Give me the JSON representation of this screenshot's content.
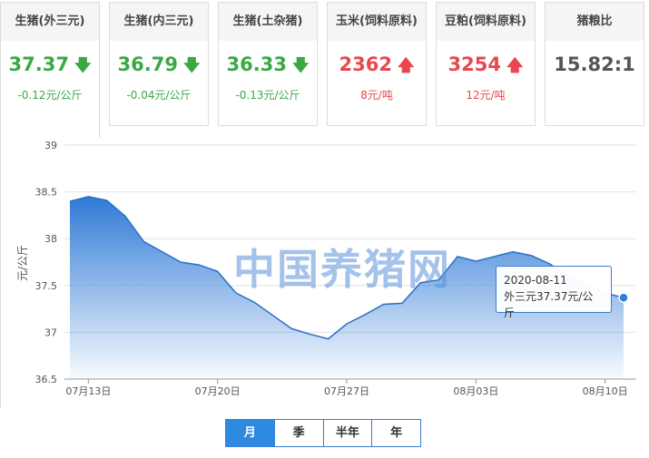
{
  "cards": [
    {
      "title": "生猪(外三元)",
      "price": "37.37",
      "change": "-0.12元/公斤",
      "trend": "down"
    },
    {
      "title": "生猪(内三元)",
      "price": "36.79",
      "change": "-0.04元/公斤",
      "trend": "down"
    },
    {
      "title": "生猪(土杂猪)",
      "price": "36.33",
      "change": "-0.13元/公斤",
      "trend": "down"
    },
    {
      "title": "玉米(饲料原料)",
      "price": "2362",
      "change": "8元/吨",
      "trend": "up"
    },
    {
      "title": "豆粕(饲料原料)",
      "price": "3254",
      "change": "12元/吨",
      "trend": "up"
    },
    {
      "title": "猪粮比",
      "price": "15.82:1",
      "change": "",
      "trend": "none"
    }
  ],
  "icons": {
    "down": "arrow-down-icon",
    "up": "arrow-up-icon"
  },
  "colors": {
    "down": "#3aa845",
    "up": "#e8474f",
    "accent": "#2d8ae0",
    "area_top": "#2f7ad6"
  },
  "chart_data": {
    "type": "area",
    "ylabel": "元/公斤",
    "ylim": [
      36.5,
      39
    ],
    "yticks": [
      "39",
      "38.5",
      "38",
      "37.5",
      "37",
      "36.5"
    ],
    "xtick_labels": [
      "07月13日",
      "07月20日",
      "07月27日",
      "08月03日",
      "08月10日"
    ],
    "xtick_days": [
      1,
      8,
      15,
      22,
      29
    ],
    "x_days": [
      0,
      1,
      2,
      3,
      4,
      5,
      6,
      7,
      8,
      9,
      10,
      11,
      12,
      13,
      14,
      15,
      16,
      17,
      18,
      19,
      20,
      21,
      22,
      23,
      24,
      25,
      26,
      27,
      28,
      29,
      30
    ],
    "values": [
      38.4,
      38.45,
      38.41,
      38.24,
      37.97,
      37.86,
      37.75,
      37.72,
      37.65,
      37.42,
      37.32,
      37.18,
      37.04,
      36.98,
      36.93,
      37.09,
      37.19,
      37.3,
      37.31,
      37.53,
      37.56,
      37.81,
      37.76,
      37.81,
      37.86,
      37.82,
      37.73,
      37.6,
      37.5,
      37.42,
      37.37
    ],
    "grid": true,
    "legend": "none",
    "watermark": "中国养猪网"
  },
  "tooltip": {
    "date": "2020-08-11",
    "text": "外三元37.37元/公斤"
  },
  "ranges": {
    "labels": [
      "月",
      "季",
      "半年",
      "年"
    ],
    "active": 0
  }
}
